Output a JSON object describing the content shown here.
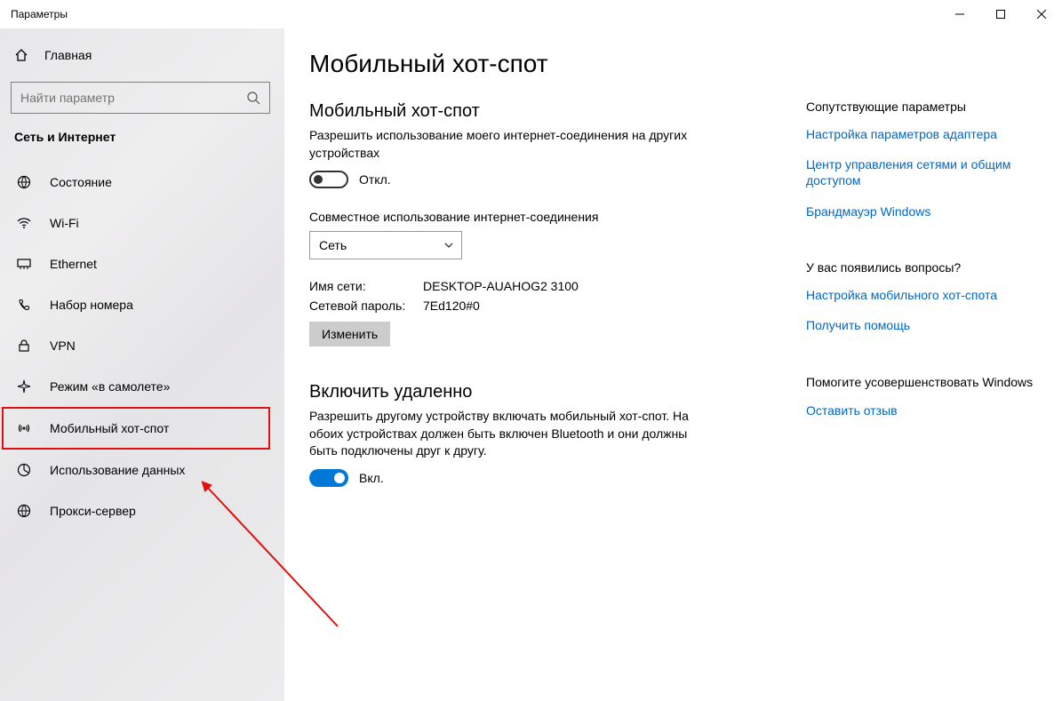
{
  "window": {
    "title": "Параметры"
  },
  "sidebar": {
    "home": "Главная",
    "searchPlaceholder": "Найти параметр",
    "category": "Сеть и Интернет",
    "items": [
      {
        "label": "Состояние"
      },
      {
        "label": "Wi-Fi"
      },
      {
        "label": "Ethernet"
      },
      {
        "label": "Набор номера"
      },
      {
        "label": "VPN"
      },
      {
        "label": "Режим «в самолете»"
      },
      {
        "label": "Мобильный хот-спот"
      },
      {
        "label": "Использование данных"
      },
      {
        "label": "Прокси-сервер"
      }
    ]
  },
  "main": {
    "title": "Мобильный хот-спот",
    "section1": {
      "heading": "Мобильный хот-спот",
      "desc": "Разрешить использование моего интернет-соединения на других устройствах",
      "toggleLabel": "Откл."
    },
    "share": {
      "label": "Совместное использование интернет-соединения",
      "selected": "Сеть"
    },
    "info": {
      "netNameLabel": "Имя сети:",
      "netNameValue": "DESKTOP-AUAHOG2 3100",
      "netPassLabel": "Сетевой пароль:",
      "netPassValue": "7Ed120#0",
      "editBtn": "Изменить"
    },
    "section2": {
      "heading": "Включить удаленно",
      "desc": "Разрешить другому устройству включать мобильный хот-спот. На обоих устройствах должен быть включен Bluetooth и они должны быть подключены друг к другу.",
      "toggleLabel": "Вкл."
    }
  },
  "aside": {
    "related": {
      "heading": "Сопутствующие параметры",
      "links": [
        "Настройка параметров адаптера",
        "Центр управления сетями и общим доступом",
        "Брандмауэр Windows"
      ]
    },
    "questions": {
      "heading": "У вас появились вопросы?",
      "links": [
        "Настройка мобильного хот-спота",
        "Получить помощь"
      ]
    },
    "improve": {
      "heading": "Помогите усовершенствовать Windows",
      "link": "Оставить отзыв"
    }
  }
}
